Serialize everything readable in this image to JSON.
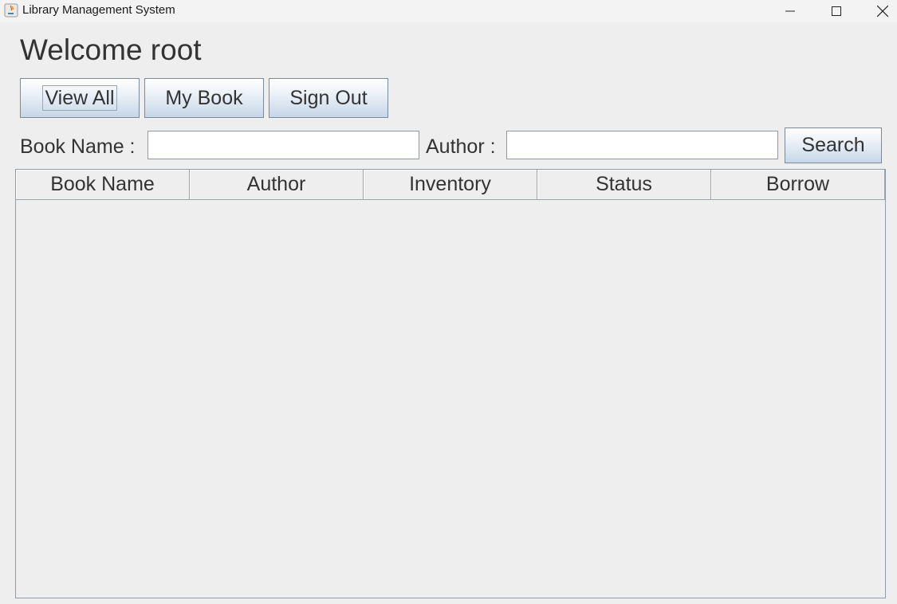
{
  "window": {
    "title": "Library Management System",
    "app_icon": "java-icon"
  },
  "header": {
    "welcome": "Welcome root"
  },
  "toolbar": {
    "view_all_label": "View All",
    "my_book_label": "My Book",
    "sign_out_label": "Sign Out"
  },
  "search": {
    "book_name_label": "Book Name :",
    "book_name_value": "",
    "author_label": "Author :",
    "author_value": "",
    "search_label": "Search"
  },
  "table": {
    "columns": [
      "Book Name",
      "Author",
      "Inventory",
      "Status",
      "Borrow"
    ],
    "rows": []
  }
}
